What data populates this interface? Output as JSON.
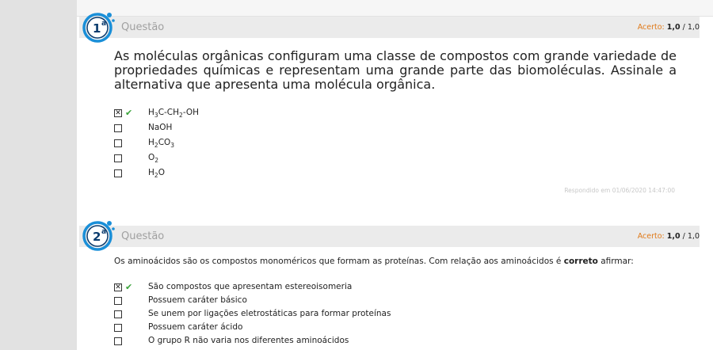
{
  "questions": [
    {
      "number": "1",
      "suffix": "a",
      "label": "Questão",
      "score_prefix": "Acerto:",
      "score_value": "1,0",
      "score_max": "/ 1,0",
      "text": "As moléculas orgânicas configuram uma classe de compostos com grande variedade de propriedades químicas e representam uma grande parte das biomoléculas. Assinale a alternativa que apresenta uma molécula orgânica.",
      "options": [
        {
          "parts": [
            [
              "H",
              ""
            ],
            [
              "3",
              "sub"
            ],
            [
              "C-CH",
              ""
            ],
            [
              "2",
              "sub"
            ],
            [
              "-OH",
              ""
            ]
          ],
          "selected": true,
          "correct": true
        },
        {
          "parts": [
            [
              "NaOH",
              ""
            ]
          ],
          "selected": false,
          "correct": false
        },
        {
          "parts": [
            [
              "H",
              ""
            ],
            [
              "2",
              "sub"
            ],
            [
              "CO",
              ""
            ],
            [
              "3",
              "sub"
            ]
          ],
          "selected": false,
          "correct": false
        },
        {
          "parts": [
            [
              "O",
              ""
            ],
            [
              "2",
              "sub"
            ]
          ],
          "selected": false,
          "correct": false
        },
        {
          "parts": [
            [
              "H",
              ""
            ],
            [
              "2",
              "sub"
            ],
            [
              "O",
              ""
            ]
          ],
          "selected": false,
          "correct": false
        }
      ],
      "answered": "Respondido em 01/06/2020 14:47:00"
    },
    {
      "number": "2",
      "suffix": "a",
      "label": "Questão",
      "score_prefix": "Acerto:",
      "score_value": "1,0",
      "score_max": "/ 1,0",
      "text_before": "Os aminoácidos são os compostos monoméricos que formam as proteínas. Com relação aos aminoácidos é ",
      "text_bold": "correto",
      "text_after": " afirmar:",
      "options": [
        {
          "text": "São compostos que apresentam estereoisomeria",
          "selected": true,
          "correct": true
        },
        {
          "text": "Possuem caráter básico",
          "selected": false,
          "correct": false
        },
        {
          "text": "Se unem por ligações eletrostáticas para formar proteínas",
          "selected": false,
          "correct": false
        },
        {
          "text": "Possuem caráter ácido",
          "selected": false,
          "correct": false
        },
        {
          "text": "O grupo R não varia nos diferentes aminoácidos",
          "selected": false,
          "correct": false
        }
      ]
    }
  ],
  "colors": {
    "badge_blue": "#1a8fd8",
    "badge_dark": "#0b3c6e",
    "score_orange": "#e07a1a",
    "tick_green": "#3aa33a"
  }
}
